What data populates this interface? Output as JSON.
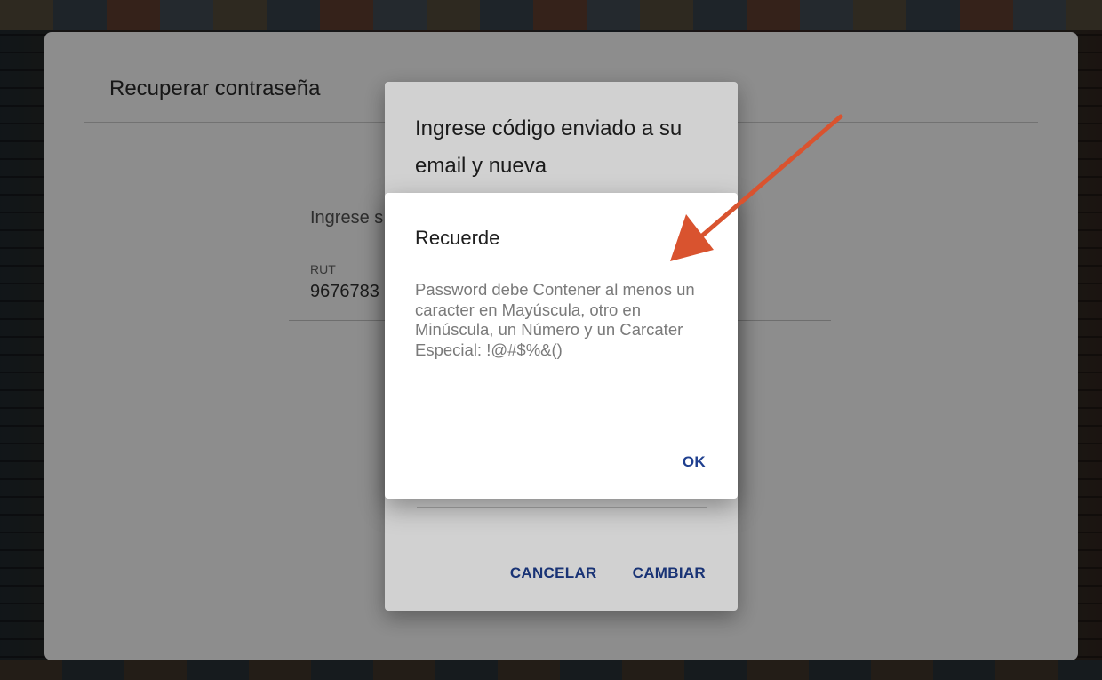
{
  "card": {
    "title": "Recuperar contraseña",
    "hint": "Ingrese s",
    "rut_label": "RUT",
    "rut_value": "9676783"
  },
  "dialog_change": {
    "title": "Ingrese código enviado a su email y nueva",
    "cancel_label": "CANCELAR",
    "change_label": "CAMBIAR"
  },
  "dialog_alert": {
    "title": "Recuerde",
    "message": "Password debe Contener al menos un caracter en Mayúscula, otro en Minúscula, un Número y un Carcater Especial: !@#$%&()",
    "ok_label": "OK"
  },
  "colors": {
    "accent": "#1f3f8f",
    "annotation_arrow": "#d9532f"
  },
  "icons": {
    "annotation": "arrow-annotation-icon"
  }
}
